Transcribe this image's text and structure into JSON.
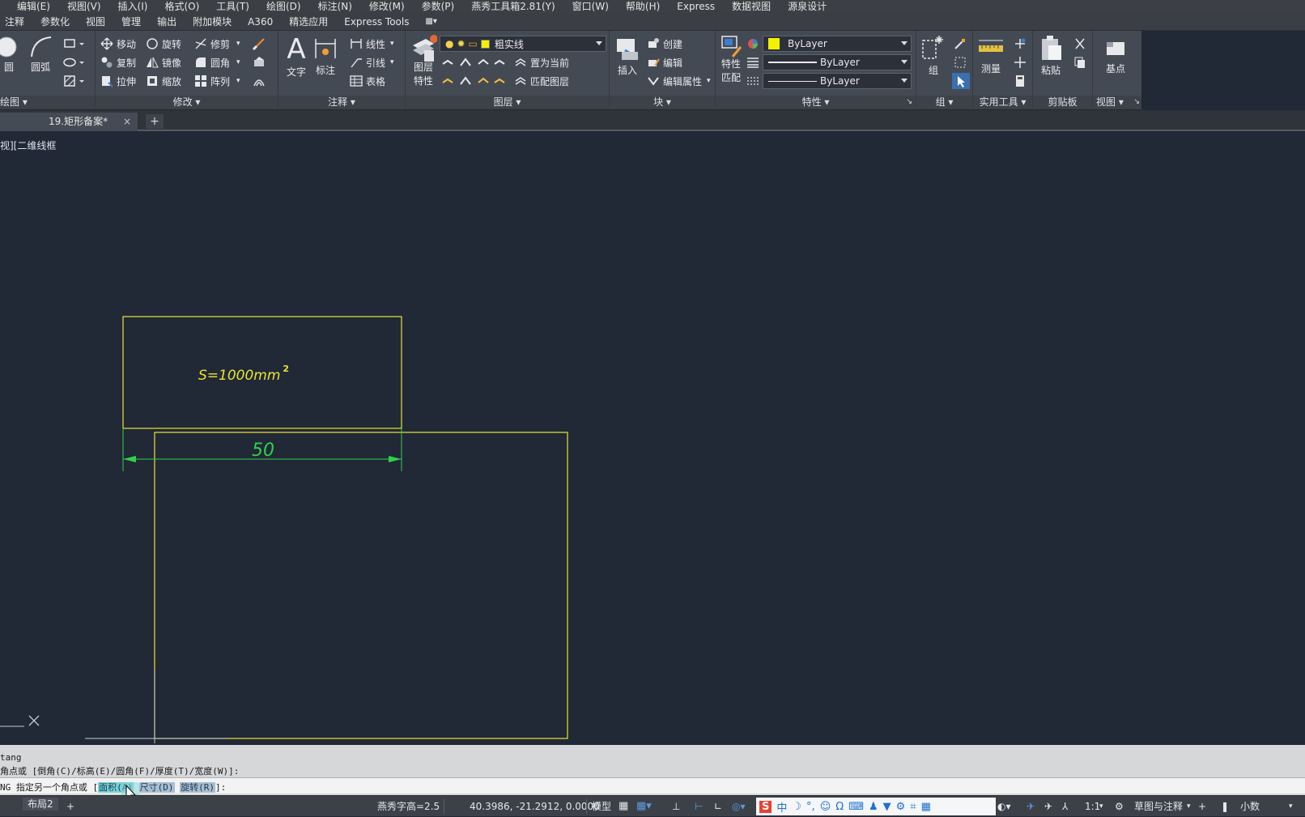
{
  "menu": [
    "编辑(E)",
    "视图(V)",
    "插入(I)",
    "格式(O)",
    "工具(T)",
    "绘图(D)",
    "标注(N)",
    "修改(M)",
    "参数(P)",
    "燕秀工具箱2.81(Y)",
    "窗口(W)",
    "帮助(H)",
    "Express",
    "数据视图",
    "源泉设计"
  ],
  "ribbon_tabs": [
    "注释",
    "参数化",
    "视图",
    "管理",
    "输出",
    "附加模块",
    "A360",
    "精选应用",
    "Express Tools"
  ],
  "ribbon": {
    "draw": {
      "circle": "圆",
      "arc": "圆弧",
      "title": "绘图"
    },
    "modify": {
      "move": "移动",
      "rotate": "旋转",
      "trim": "修剪",
      "copy": "复制",
      "mirror": "镜像",
      "fillet": "圆角",
      "stretch": "拉伸",
      "scale": "缩放",
      "array": "阵列",
      "title": "修改"
    },
    "annotation": {
      "text": "文字",
      "dimension": "标注",
      "linear": "线性",
      "leader": "引线",
      "table": "表格",
      "title": "注释"
    },
    "layers": {
      "layer_props_l1": "图层",
      "layer_props_l2": "特性",
      "current_layer": "粗实线",
      "set_current": "置为当前",
      "match_layer": "匹配图层",
      "title": "图层"
    },
    "block": {
      "insert": "插入",
      "create": "创建",
      "edit": "编辑",
      "edit_attr": "编辑属性",
      "title": "块"
    },
    "properties": {
      "match_l1": "特性",
      "match_l2": "匹配",
      "color": "ByLayer",
      "lineweight": "ByLayer",
      "linetype": "ByLayer",
      "title": "特性"
    },
    "groups": {
      "group": "组",
      "title": "组"
    },
    "utilities": {
      "measure": "测量",
      "title": "实用工具"
    },
    "clipboard": {
      "paste": "粘贴",
      "title": "剪贴板"
    },
    "view": {
      "base": "基点",
      "title": "视图"
    }
  },
  "document": {
    "tab": "19.矩形备案*",
    "close": "×",
    "add": "+"
  },
  "viewport_label": "视][二维线框",
  "drawing": {
    "area_text": "S=1000mm",
    "area_sup": "2",
    "dimension_text": "50"
  },
  "command": {
    "line1": "tang",
    "line2": "角点或 [倒角(C)/标高(E)/圆角(F)/厚度(T)/宽度(W)]:",
    "prompt_prefix": "NG 指定另一个角点或 [",
    "opt_area": "面积(A)",
    "opt_size": "尺寸(D)",
    "opt_rotate": "旋转(R)",
    "prompt_suffix": "]:"
  },
  "status": {
    "layout_tab": "布局2",
    "add": "+",
    "text_height": "燕秀字高=2.5",
    "coords": "40.3986, -21.2912, 0.0000",
    "model": "模型",
    "scale": "1:1",
    "workspace": "草图与注释",
    "units": "小数"
  },
  "colors": {
    "canvas": "#212836",
    "yellow_geometry": "#e6e632",
    "green_dimension": "#2fd14a",
    "accent": "#2a90d8"
  }
}
